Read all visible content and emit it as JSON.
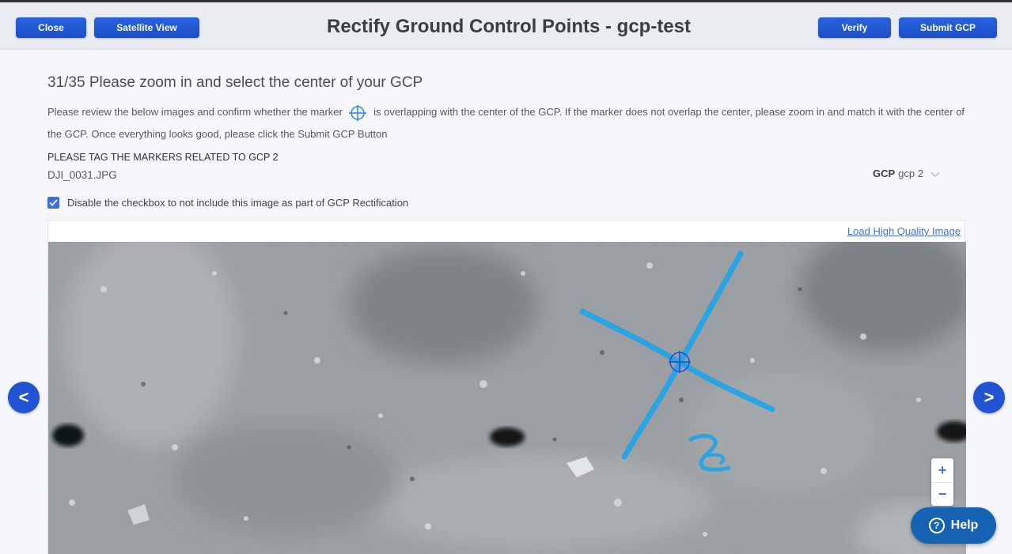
{
  "header": {
    "title": "Rectify Ground Control Points - gcp-test",
    "close_label": "Close",
    "satellite_label": "Satellite View",
    "verify_label": "Verify",
    "submit_label": "Submit GCP"
  },
  "main": {
    "heading": "31/35 Please zoom in and select the center of your GCP",
    "description_before": "Please review the below images and confirm whether the marker",
    "description_after": "is overlapping with the center of the GCP. If the marker does not overlap the center, please zoom in and match it with the center of the GCP. Once everything looks good, please click the Submit GCP Button",
    "tag_instruction": "PLEASE TAG THE MARKERS RELATED TO GCP 2",
    "filename": "DJI_0031.JPG",
    "gcp_select": {
      "label": "GCP",
      "value": "gcp 2"
    },
    "checkbox": {
      "checked": true,
      "label": "Disable the checkbox to not include this image as part of GCP Rectification"
    },
    "load_hq_label": "Load High Quality Image",
    "photo_annotation": "2"
  },
  "map_controls": {
    "zoom_in": "+",
    "zoom_out": "−"
  },
  "nav": {
    "prev": "<",
    "next": ">"
  },
  "help": {
    "icon": "?",
    "label": "Help"
  },
  "colors": {
    "primary": "#1f56d4",
    "marker": "#1f9fe8",
    "help": "#1663b3"
  },
  "icons": [
    "crosshair-icon",
    "chevron-down-icon",
    "checkmark-icon",
    "question-icon"
  ]
}
